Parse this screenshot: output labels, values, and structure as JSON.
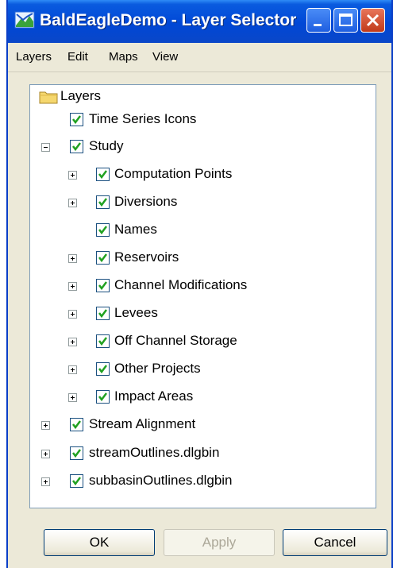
{
  "window": {
    "title": "BaldEagleDemo - Layer Selector"
  },
  "menu": [
    "Layers",
    "Edit",
    "Maps",
    "View"
  ],
  "tree": {
    "root_label": "Layers",
    "items": [
      {
        "label": "Time Series Icons",
        "checked": true
      },
      {
        "label": "Study",
        "checked": true,
        "expanded": true
      },
      {
        "label": "Computation Points",
        "checked": true
      },
      {
        "label": "Diversions",
        "checked": true
      },
      {
        "label": "Names",
        "checked": true
      },
      {
        "label": "Reservoirs",
        "checked": true
      },
      {
        "label": "Channel Modifications",
        "checked": true
      },
      {
        "label": "Levees",
        "checked": true
      },
      {
        "label": "Off Channel Storage",
        "checked": true
      },
      {
        "label": "Other Projects",
        "checked": true
      },
      {
        "label": "Impact Areas",
        "checked": true
      },
      {
        "label": "Stream Alignment",
        "checked": true
      },
      {
        "label": "streamOutlines.dlgbin",
        "checked": true
      },
      {
        "label": "subbasinOutlines.dlgbin",
        "checked": true
      }
    ]
  },
  "buttons": {
    "ok": "OK",
    "apply": "Apply",
    "cancel": "Cancel"
  }
}
